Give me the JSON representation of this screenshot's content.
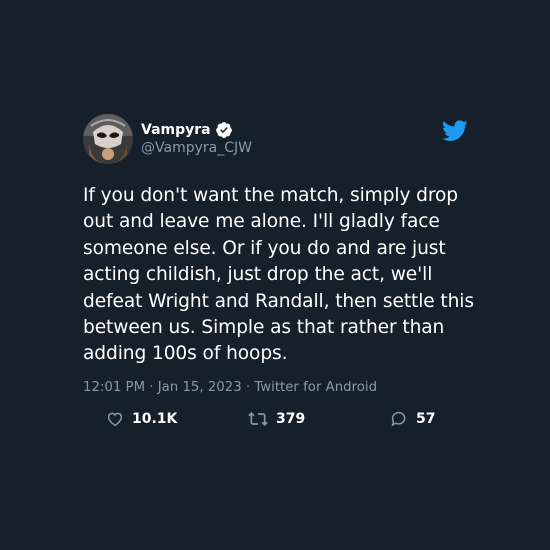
{
  "tweet": {
    "display_name": "Vampyra",
    "handle": "@Vampyra_CJW",
    "verified": true,
    "text": "If you don't want the match, simply drop out and leave me alone. I'll gladly face someone else. Or if you do and are just acting childish, just drop the act, we'll defeat Wright and Randall, then settle this between us. Simple as that rather than adding 100s of hoops.",
    "meta": "12:01 PM · Jan 15, 2023 · Twitter for Android"
  },
  "actions": {
    "likes": "10.1K",
    "retweets": "379",
    "replies": "57"
  },
  "colors": {
    "background": "#15202b",
    "accent": "#1d9bf0",
    "muted": "#8899a6"
  },
  "icons": [
    "verified-badge-icon",
    "twitter-bird-icon",
    "heart-icon",
    "retweet-icon",
    "reply-icon"
  ]
}
